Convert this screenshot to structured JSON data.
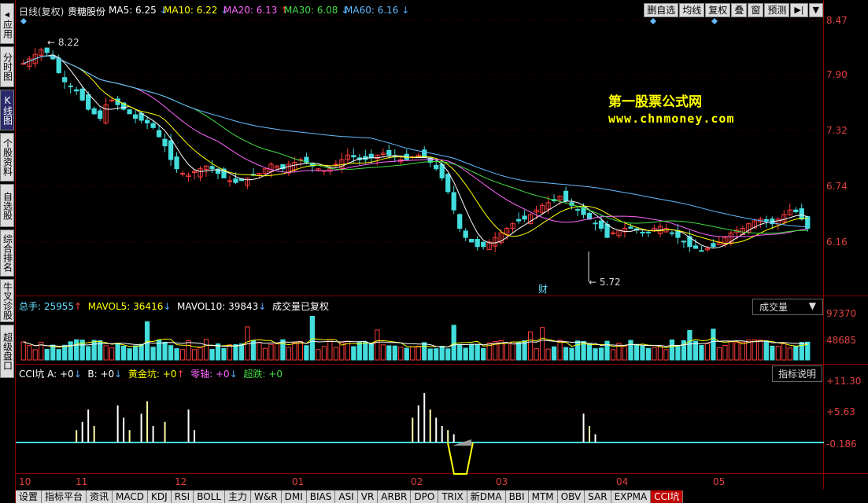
{
  "left_nav": [
    {
      "label": "应用",
      "active": false
    },
    {
      "label": "分时图",
      "active": false
    },
    {
      "label": "K线图",
      "active": true
    },
    {
      "label": "个股资料",
      "active": false
    },
    {
      "label": "自选股",
      "active": false
    },
    {
      "label": "综合排名",
      "active": false
    },
    {
      "label": "牛叉诊股",
      "active": false
    },
    {
      "label": "超级盘口",
      "active": false
    }
  ],
  "header": {
    "period": "日线(复权)",
    "stock": "贵糖股份",
    "ma5": "MA5: 6.25",
    "ma10": "MA10: 6.22",
    "ma20": "MA20: 6.13",
    "ma30": "MA30: 6.08",
    "ma60": "MA60: 6.16",
    "colors": {
      "ma5": "#ffffff",
      "ma10": "#ffff00",
      "ma20": "#ff66ff",
      "ma30": "#44dd44",
      "ma60": "#66bbff"
    }
  },
  "toolbar": {
    "items": [
      "删自选",
      "均线",
      "复权",
      "叠",
      "窗",
      "预测"
    ],
    "end_icon": "▶|",
    "menu_icon": "▼"
  },
  "price_axis": [
    "8.47",
    "7.90",
    "7.32",
    "6.74",
    "6.16"
  ],
  "annotations": {
    "high": "8.22",
    "low": "5.72",
    "cai": "财"
  },
  "watermark": {
    "line1": "第一股票公式网",
    "line2": "www.chnmoney.com"
  },
  "volume": {
    "total": "总手: 25955",
    "mavol5": "MAVOL5: 36416",
    "mavol10": "MAVOL10: 39843",
    "note": "成交量已复权",
    "selector": "成交量",
    "axis": [
      "97370",
      "48685"
    ]
  },
  "indicator": {
    "name": "CCI坑",
    "a": "A: +0",
    "b": "B: +0",
    "gold": "黄金坑: +0",
    "zero": "零轴: +0",
    "over": "超跌: +0",
    "help": "指标说明",
    "axis": [
      "+11.30",
      "+5.63",
      "-0.186"
    ]
  },
  "dates": [
    "10",
    "11",
    "12",
    "01",
    "02",
    "03",
    "04",
    "05"
  ],
  "bottom_tabs": [
    "设置",
    "指标平台",
    "资讯",
    "MACD",
    "KDJ",
    "RSI",
    "BOLL",
    "主力",
    "W&R",
    "DMI",
    "BIAS",
    "ASI",
    "VR",
    "ARBR",
    "DPO",
    "TRIX",
    "新DMA",
    "BBI",
    "MTM",
    "OBV",
    "SAR",
    "EXPMA",
    "CCI坑"
  ],
  "active_bottom_tab": "CCI坑",
  "chart_data": {
    "type": "candlestick",
    "price_range": [
      5.5,
      8.47
    ],
    "closes": [
      8.0,
      8.05,
      8.1,
      8.15,
      8.12,
      8.05,
      7.9,
      7.8,
      7.75,
      7.7,
      7.6,
      7.5,
      7.45,
      7.4,
      7.55,
      7.6,
      7.55,
      7.5,
      7.45,
      7.4,
      7.38,
      7.35,
      7.3,
      7.2,
      7.1,
      6.95,
      6.85,
      6.8,
      6.78,
      6.82,
      6.85,
      6.88,
      6.85,
      6.8,
      6.75,
      6.72,
      6.7,
      6.72,
      6.75,
      6.78,
      6.8,
      6.85,
      6.9,
      6.88,
      6.85,
      6.9,
      6.92,
      6.95,
      6.92,
      6.88,
      6.85,
      6.83,
      6.85,
      6.9,
      6.95,
      7.0,
      6.98,
      6.95,
      6.95,
      6.97,
      7.0,
      7.02,
      7.0,
      6.98,
      6.95,
      6.95,
      6.98,
      7.0,
      6.98,
      6.92,
      6.85,
      6.75,
      6.6,
      6.4,
      6.2,
      6.1,
      6.05,
      6.0,
      6.0,
      6.05,
      6.1,
      6.15,
      6.2,
      6.25,
      6.28,
      6.3,
      6.35,
      6.4,
      6.45,
      6.48,
      6.5,
      6.55,
      6.5,
      6.45,
      6.4,
      6.35,
      6.3,
      6.25,
      6.2,
      6.1,
      6.15,
      6.18,
      6.2,
      6.2,
      6.18,
      6.15,
      6.15,
      6.2,
      6.22,
      6.2,
      6.15,
      6.1,
      6.05,
      6.0,
      5.98,
      5.95,
      5.98,
      6.0,
      6.05,
      6.1,
      6.15,
      6.18,
      6.2,
      6.25,
      6.28,
      6.3,
      6.28,
      6.25,
      6.3,
      6.35,
      6.4,
      6.38,
      6.3,
      6.2
    ],
    "volume_range": [
      0,
      97370
    ],
    "cci_range": [
      -0.186,
      11.3
    ]
  }
}
